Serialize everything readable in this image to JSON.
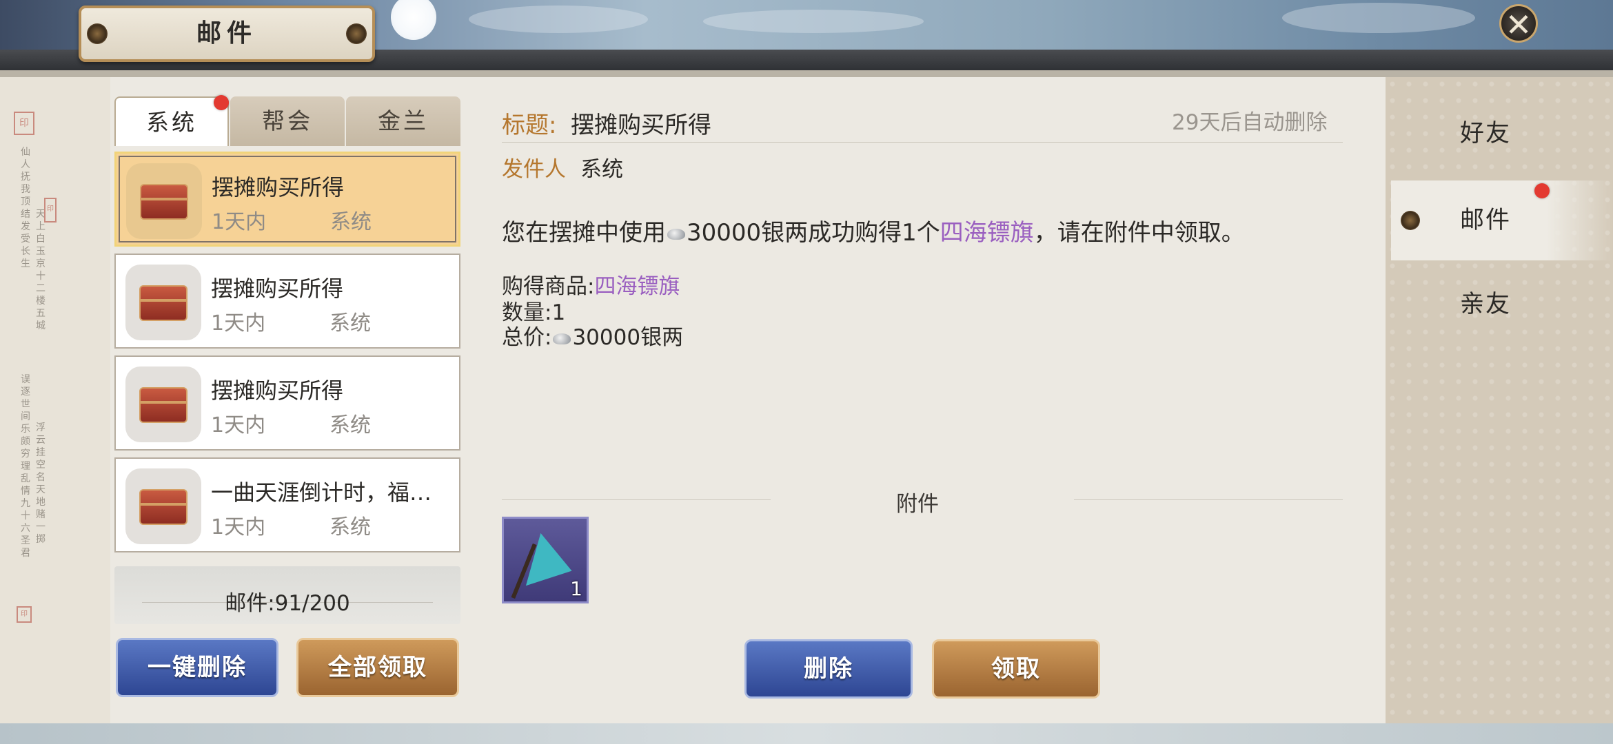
{
  "header": {
    "title": "邮件",
    "close_icon": "close-icon"
  },
  "tabs": [
    {
      "label": "系统",
      "active": true,
      "has_dot": true
    },
    {
      "label": "帮会",
      "active": false
    },
    {
      "label": "金兰",
      "active": false
    }
  ],
  "mail_list": [
    {
      "subject": "摆摊购买所得",
      "time": "1天内",
      "sender": "系统",
      "selected": true
    },
    {
      "subject": "摆摊购买所得",
      "time": "1天内",
      "sender": "系统",
      "selected": false
    },
    {
      "subject": "摆摊购买所得",
      "time": "1天内",
      "sender": "系统",
      "selected": false
    },
    {
      "subject": "一曲天涯倒计时，福…",
      "time": "1天内",
      "sender": "系统",
      "selected": false
    }
  ],
  "mail_count": "邮件:91/200",
  "left_buttons": {
    "delete_all": "一键删除",
    "claim_all": "全部领取"
  },
  "detail": {
    "title_label": "标题:",
    "title": "摆摊购买所得",
    "expire": "29天后自动删除",
    "sender_label": "发件人",
    "sender": "系统",
    "body_prefix": "您在摆摊中使用",
    "body_amount": "30000银两成功购得1个",
    "body_item": "四海镖旗",
    "body_suffix": "，请在附件中领取。",
    "goods_label": "购得商品:",
    "goods_item": "四海镖旗",
    "quantity": "数量:1",
    "total_label": "总价:",
    "total_value": "30000银两",
    "attachment_label": "附件",
    "attachment_qty": "1"
  },
  "detail_buttons": {
    "delete": "删除",
    "claim": "领取"
  },
  "side_nav": [
    {
      "label": "好友",
      "active": false
    },
    {
      "label": "邮件",
      "active": true,
      "has_dot": true
    },
    {
      "label": "亲友",
      "active": false
    }
  ],
  "colors": {
    "accent_gold": "#b5772e",
    "item_purple": "#9a5fc0",
    "notify_red": "#e33a31",
    "button_blue": "#2e4693",
    "button_gold": "#9a6430"
  }
}
